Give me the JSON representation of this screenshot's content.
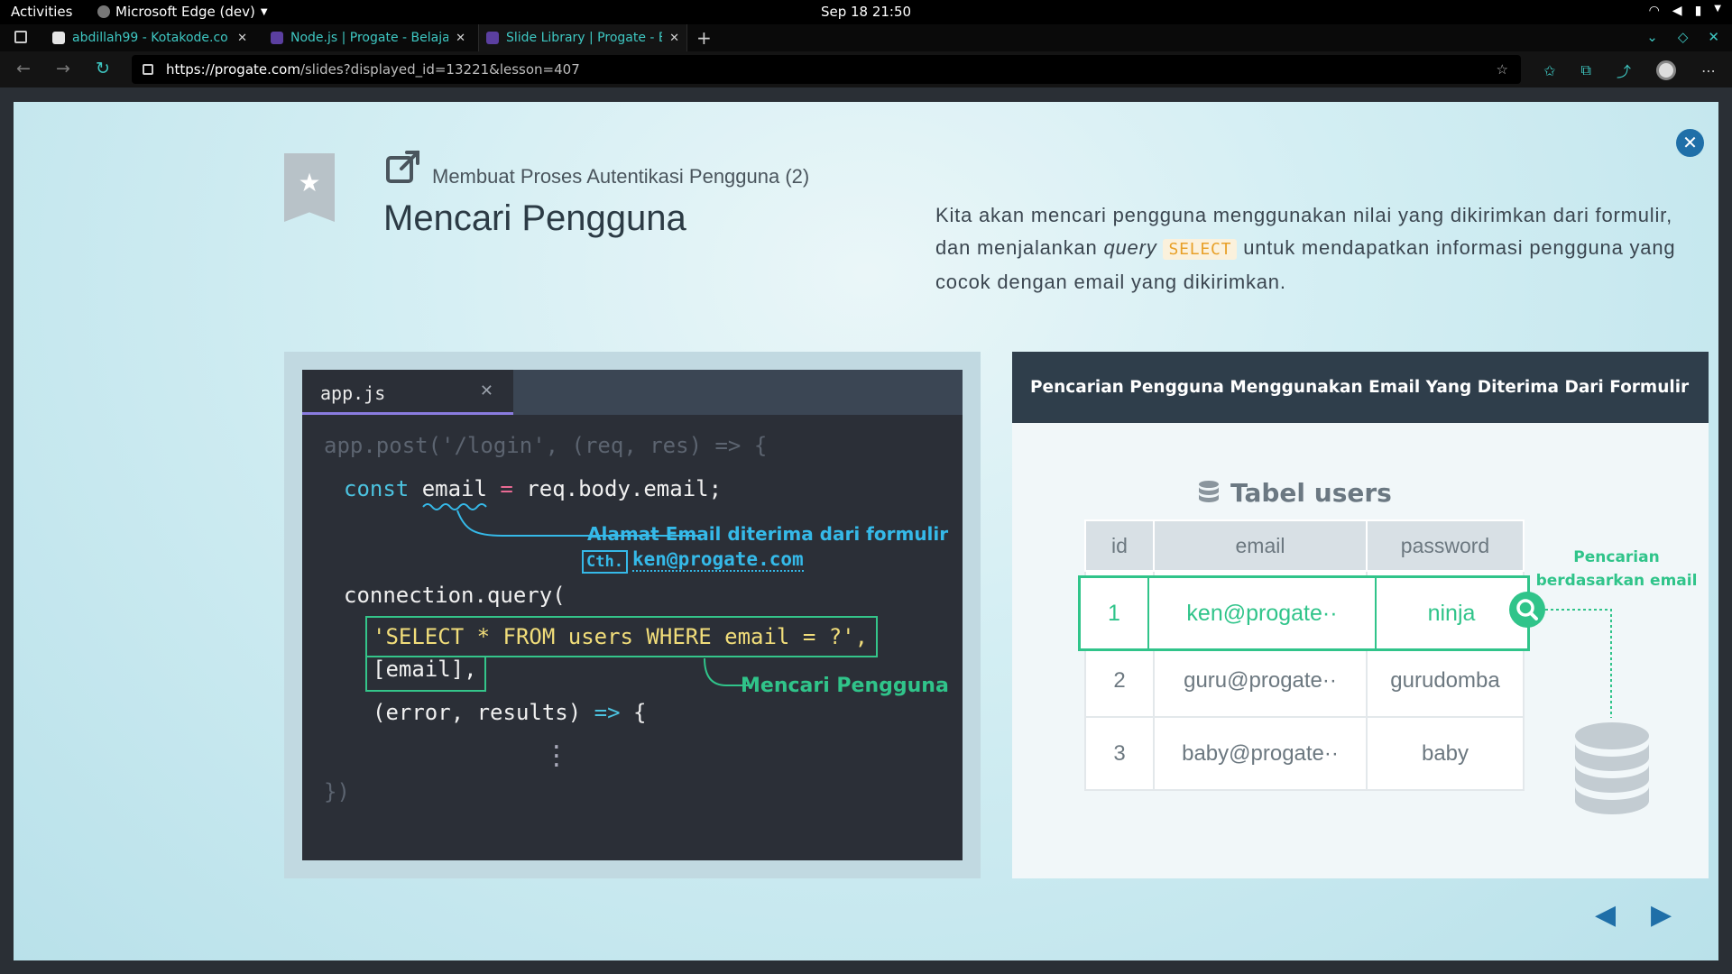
{
  "system": {
    "activities": "Activities",
    "app_menu": "Microsoft Edge (dev)",
    "clock": "Sep 18  21:50"
  },
  "browser": {
    "tabs": [
      {
        "title": "abdillah99 - Kotakode.co",
        "favicon_color": "#e5e5e5"
      },
      {
        "title": "Node.js | Progate - Belaja",
        "favicon_color": "#5b3fa0"
      },
      {
        "title": "Slide Library | Progate - B",
        "favicon_color": "#5b3fa0"
      }
    ],
    "new_tab": "+",
    "url_host": "https://progate.com",
    "url_path": "/slides?displayed_id=13221&lesson=407"
  },
  "slide": {
    "subtitle": "Membuat Proses Autentikasi Pengguna (2)",
    "title": "Mencari Pengguna",
    "desc_part1": "Kita akan mencari pengguna menggunakan nilai yang dikirimkan dari formulir, dan menjalankan ",
    "desc_italic": "query",
    "desc_keyword": "SELECT",
    "desc_part2": " untuk mendapatkan informasi pengguna yang cocok dengan email yang dikirimkan.",
    "code": {
      "filename": "app.js",
      "line1": "app.post('/login', (req, res) => {",
      "line2_kw": "const",
      "line2_var": "email",
      "line2_eq": "=",
      "line2_rest": "req.body.email;",
      "annotation_email": "Alamat Email diterima dari formulir",
      "example_tag": "Cth.",
      "example_email": "ken@progate.com",
      "line3": "connection.query(",
      "line4": "'SELECT * FROM users WHERE email = ?',",
      "line5": "[email],",
      "annotation_search": "Mencari Pengguna",
      "line6_args": "(error, results)",
      "line6_arrow": "=>",
      "line6_brace": "{",
      "line_end": "})"
    },
    "diagram": {
      "header": "Pencarian Pengguna Menggunakan Email Yang Diterima Dari Formulir",
      "table_title": "Tabel users",
      "columns": [
        "id",
        "email",
        "password"
      ],
      "rows": [
        [
          "1",
          "ken@progate··",
          "ninja"
        ],
        [
          "2",
          "guru@progate··",
          "gurudomba"
        ],
        [
          "3",
          "baby@progate··",
          "baby"
        ]
      ],
      "search_label_line1": "Pencarian",
      "search_label_line2": "berdasarkan email"
    }
  },
  "colors": {
    "accent_green": "#30c48a",
    "accent_blue": "#35b9e8",
    "close_blue": "#1f6fa8"
  }
}
